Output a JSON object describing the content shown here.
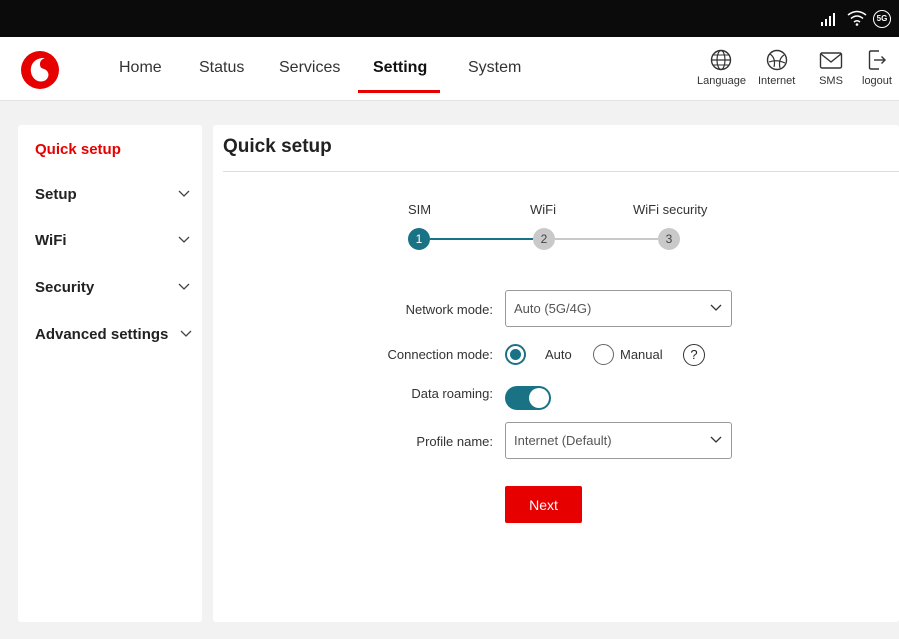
{
  "status_bar": {
    "network_badge": "5G",
    "icons": [
      "signal-icon",
      "wifi-icon",
      "network-5g-icon"
    ]
  },
  "header": {
    "logo": "vodafone-logo",
    "nav": {
      "home": "Home",
      "status": "Status",
      "services": "Services",
      "setting": "Setting",
      "system": "System"
    },
    "active_nav": "Setting",
    "actions": {
      "language": "Language",
      "internet": "Internet",
      "sms": "SMS",
      "logout": "logout"
    }
  },
  "sidebar": {
    "items": [
      {
        "label": "Quick setup",
        "active": true
      },
      {
        "label": "Setup",
        "expandable": true
      },
      {
        "label": "WiFi",
        "expandable": true
      },
      {
        "label": "Security",
        "expandable": true
      },
      {
        "label": "Advanced settings",
        "expandable": true
      }
    ]
  },
  "main": {
    "title": "Quick setup",
    "steps": [
      {
        "label": "SIM",
        "number": "1",
        "state": "current"
      },
      {
        "label": "WiFi",
        "number": "2",
        "state": "pending"
      },
      {
        "label": "WiFi security",
        "number": "3",
        "state": "pending"
      }
    ],
    "form": {
      "network_mode": {
        "label": "Network mode:",
        "value": "Auto (5G/4G)"
      },
      "connection_mode": {
        "label": "Connection mode:",
        "options": [
          "Auto",
          "Manual"
        ],
        "selected": "Auto",
        "help_glyph": "?"
      },
      "data_roaming": {
        "label": "Data roaming:",
        "enabled": true
      },
      "profile_name": {
        "label": "Profile name:",
        "value": "Internet (Default)"
      }
    },
    "next_label": "Next"
  },
  "colors": {
    "brand_red": "#e60000",
    "accent_teal": "#1a7285",
    "inactive_grey": "#c9c9c9"
  }
}
